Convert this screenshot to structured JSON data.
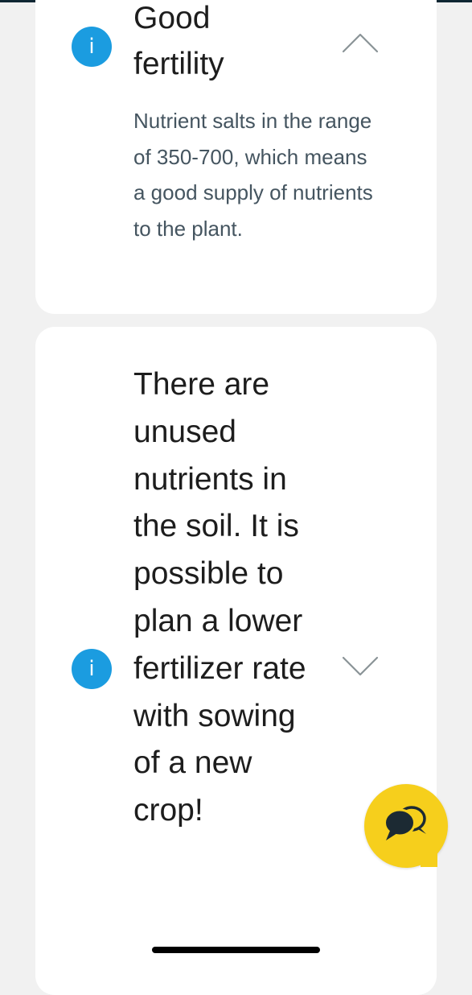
{
  "cards": [
    {
      "title": "Good fertility",
      "description": "Nutrient salts in the range of 350-700, which means a good supply of nutrients to the plant.",
      "expanded": true,
      "info_icon_label": "i"
    },
    {
      "title": "There are unused nutrients in the soil. It is possible to plan a lower fertilizer rate with sowing of a new crop!",
      "expanded": false,
      "info_icon_label": "i"
    }
  ],
  "icons": {
    "info": "info-icon",
    "expand_collapse": "chevron-icon",
    "chat": "chat-bubbles-icon"
  },
  "colors": {
    "background": "#f1f1f1",
    "card": "#ffffff",
    "info_accent": "#1b9ce0",
    "chat_button": "#f6cf1c",
    "title_text": "#1d1d1d",
    "description_text": "#455560",
    "chevron": "#8a9397"
  }
}
